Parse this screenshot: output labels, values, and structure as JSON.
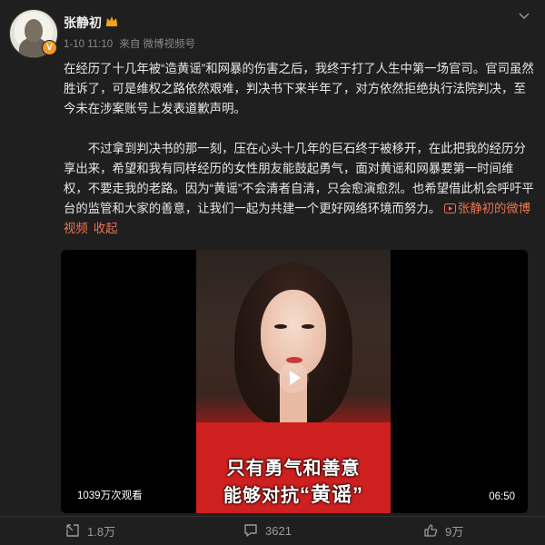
{
  "post": {
    "author": {
      "name": "张静初",
      "verified_badge": "V",
      "avatar_icon": "avatar"
    },
    "meta": {
      "time": "1-10 11:10",
      "source": "来自 微博视频号"
    },
    "paragraphs": [
      "在经历了十几年被“造黄谣”和网暴的伤害之后，我终于打了人生中第一场官司。官司虽然胜诉了，可是维权之路依然艰难，判决书下来半年了，对方依然拒绝执行法院判决，至今未在涉案账号上发表道歉声明。",
      "不过拿到判决书的那一刻，压在心头十几年的巨石终于被移开，在此把我的经历分享出来，希望和我有同样经历的女性朋友能鼓起勇气，面对黄谣和网暴要第一时间维权，不要走我的老路。因为“黄谣”不会清者自清，只会愈演愈烈。也希望借此机会呼吁平台的监管和大家的善意，让我们一起为共建一个更好网络环境而努力。"
    ],
    "video_link_label": "张静初的微博视频",
    "collapse_label": "收起",
    "video": {
      "caption_line1": "只有勇气和善意",
      "caption_line2_prefix": "能够对抗",
      "caption_line2_highlight": "“黄谣”",
      "views": "1039万次观看",
      "duration": "06:50"
    },
    "actions": {
      "repost": "1.8万",
      "comment": "3621",
      "like": "9万"
    }
  },
  "colors": {
    "background": "#1f1f1f",
    "link": "#eb7350",
    "badge": "#f29b27",
    "shirt": "#cf2020"
  }
}
